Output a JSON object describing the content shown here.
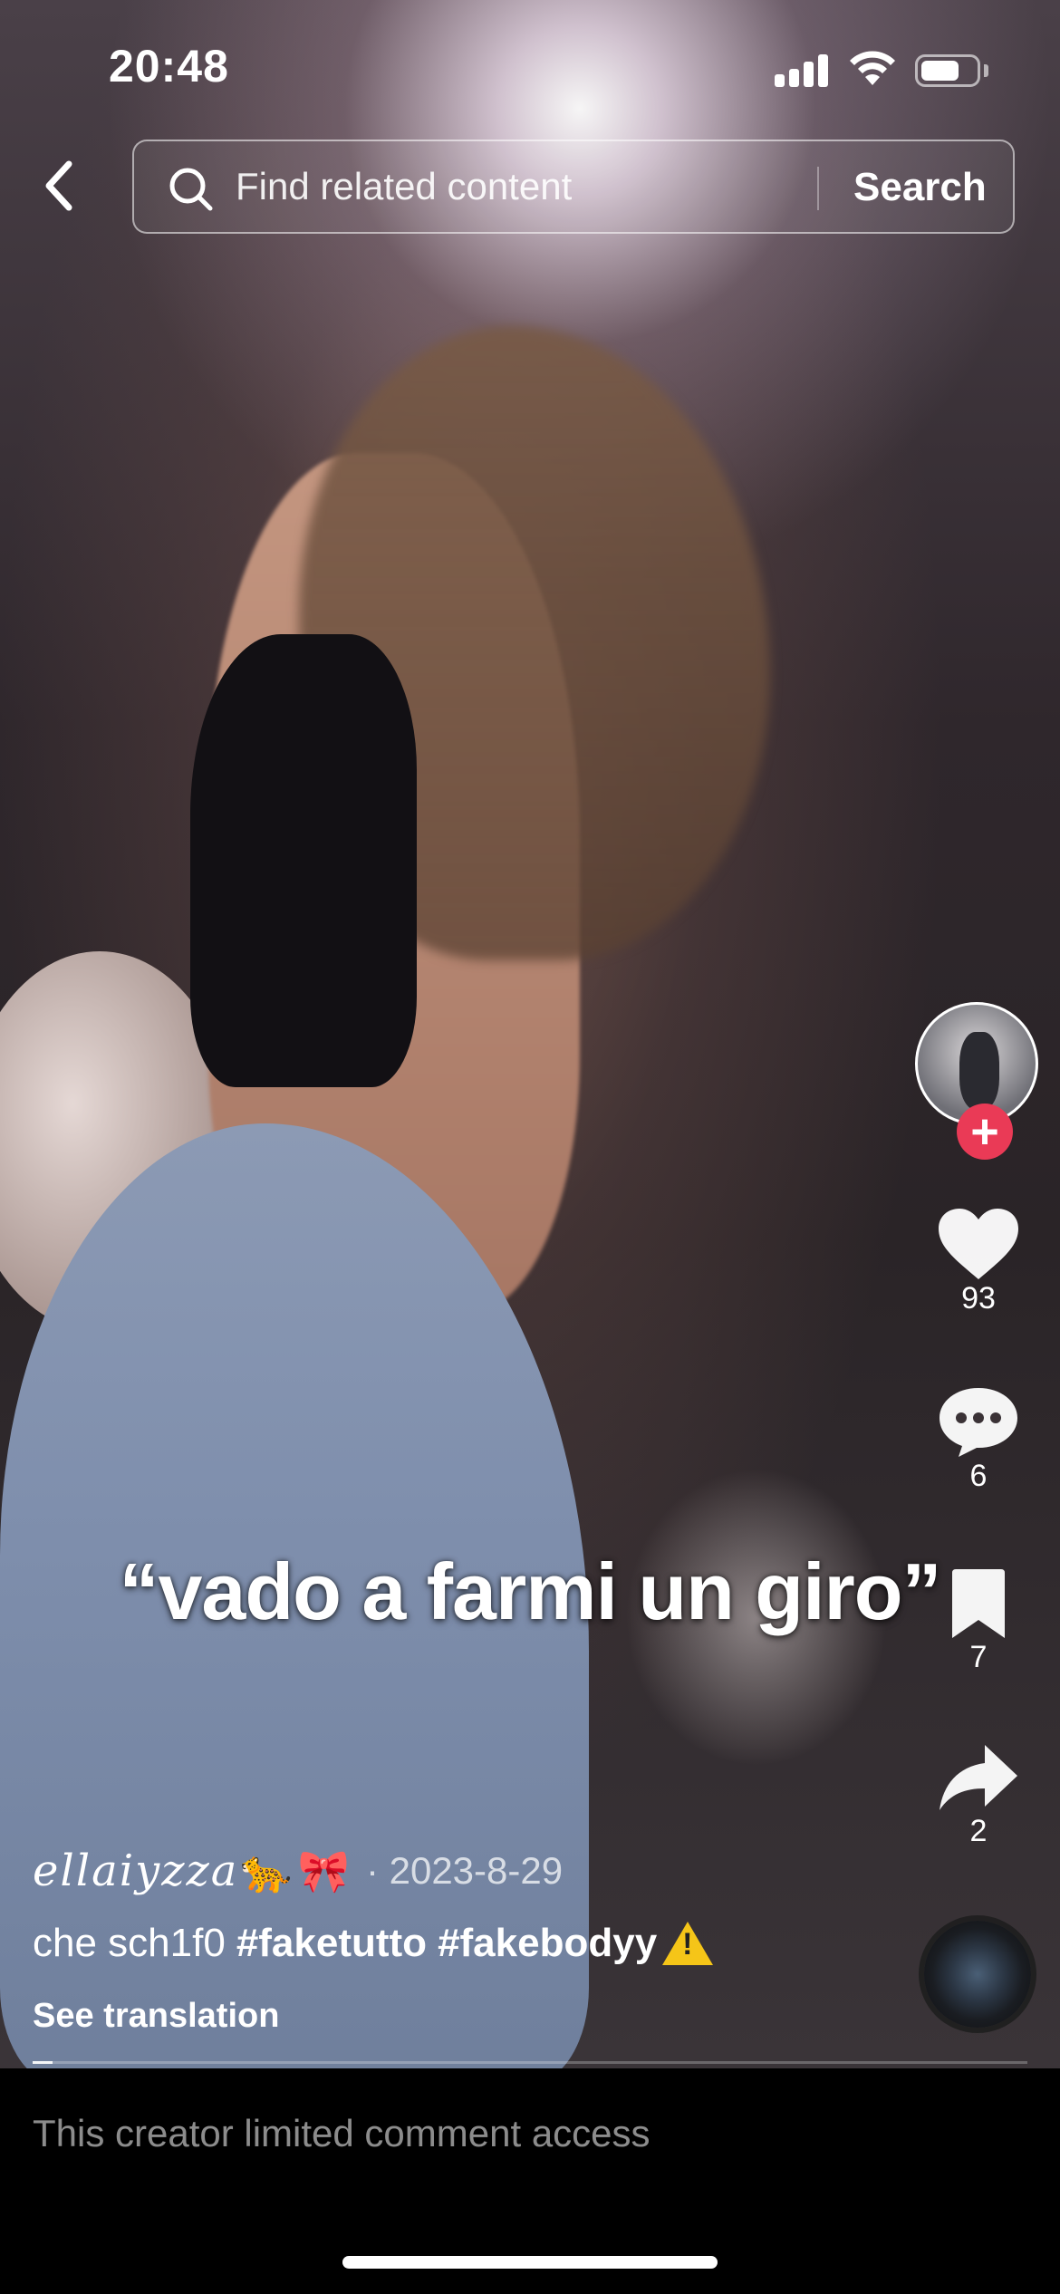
{
  "status_bar": {
    "time": "20:48",
    "battery_level": 0.7
  },
  "search": {
    "placeholder": "Find related content",
    "button_label": "Search"
  },
  "video": {
    "overlay_caption": "“vado a farmi un giro”"
  },
  "actions": {
    "likes": "93",
    "comments": "6",
    "bookmarks": "7",
    "shares": "2"
  },
  "post": {
    "author": "ellaiyzza",
    "author_emoji_1": "🐆",
    "author_emoji_2": "🎀",
    "date": "· 2023-8-29",
    "description_text": "che sch1f0",
    "hashtags": [
      "#faketutto",
      "#fakebodyy"
    ],
    "see_translation": "See translation"
  },
  "playback": {
    "progress": 0.02
  },
  "comment_bar": {
    "text": "This creator limited comment access"
  },
  "icons": {
    "back": "chevron-left-icon",
    "search": "search-icon",
    "like": "heart-icon",
    "comment": "comment-icon",
    "bookmark": "bookmark-icon",
    "share": "share-icon",
    "warning": "warning-icon"
  },
  "colors": {
    "follow_button": "#ea3a56",
    "accent_text": "#ffffff"
  }
}
